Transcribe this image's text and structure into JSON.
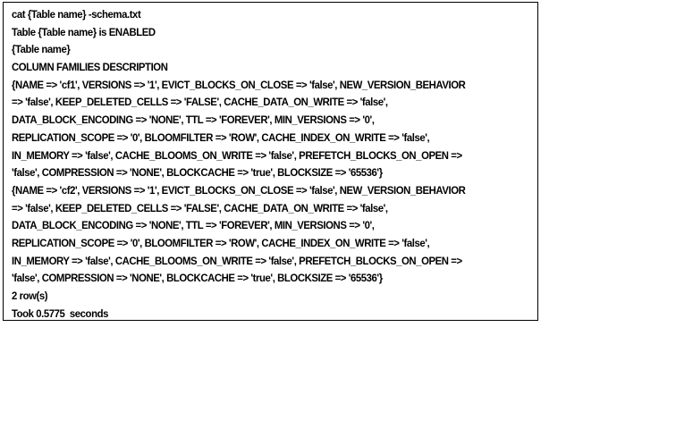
{
  "document": {
    "lines": [
      "cat {Table name} -schema.txt",
      "Table {Table name} is ENABLED",
      "{Table name}",
      "COLUMN FAMILIES DESCRIPTION",
      "{NAME => 'cf1', VERSIONS => '1', EVICT_BLOCKS_ON_CLOSE => 'false', NEW_VERSION_BEHAVIOR",
      "=> 'false', KEEP_DELETED_CELLS => 'FALSE', CACHE_DATA_ON_WRITE => 'false',",
      "DATA_BLOCK_ENCODING => 'NONE', TTL => 'FOREVER', MIN_VERSIONS => '0',",
      "REPLICATION_SCOPE => '0', BLOOMFILTER => 'ROW', CACHE_INDEX_ON_WRITE => 'false',",
      "IN_MEMORY => 'false', CACHE_BLOOMS_ON_WRITE => 'false', PREFETCH_BLOCKS_ON_OPEN =>",
      "'false', COMPRESSION => 'NONE', BLOCKCACHE => 'true', BLOCKSIZE => '65536'}",
      "{NAME => 'cf2', VERSIONS => '1', EVICT_BLOCKS_ON_CLOSE => 'false', NEW_VERSION_BEHAVIOR",
      "=> 'false', KEEP_DELETED_CELLS => 'FALSE', CACHE_DATA_ON_WRITE => 'false',",
      "DATA_BLOCK_ENCODING => 'NONE', TTL => 'FOREVER', MIN_VERSIONS => '0',",
      "REPLICATION_SCOPE => '0', BLOOMFILTER => 'ROW', CACHE_INDEX_ON_WRITE => 'false',",
      "IN_MEMORY => 'false', CACHE_BLOOMS_ON_WRITE => 'false', PREFETCH_BLOCKS_ON_OPEN =>",
      "'false', COMPRESSION => 'NONE', BLOCKCACHE => 'true', BLOCKSIZE => '65536'}",
      "2 row(s)",
      "Took 0.5775  seconds"
    ]
  }
}
